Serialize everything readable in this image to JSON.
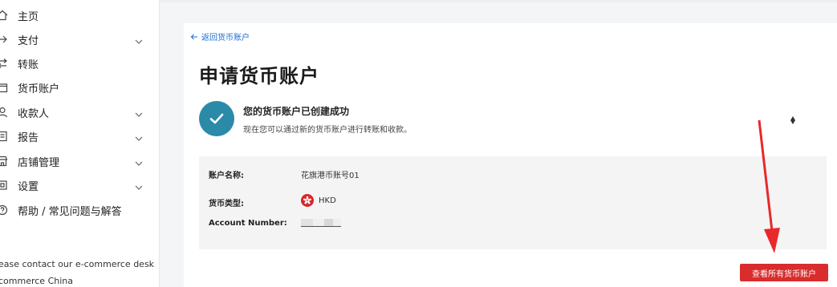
{
  "sidebar": {
    "items": [
      {
        "label": "主页",
        "icon": "home-icon",
        "chevron": false
      },
      {
        "label": "支付",
        "icon": "payment-arrow-icon",
        "chevron": true
      },
      {
        "label": "转账",
        "icon": "transfer-icon",
        "chevron": false
      },
      {
        "label": "货币账户",
        "icon": "wallet-icon",
        "chevron": false
      },
      {
        "label": "收款人",
        "icon": "person-icon",
        "chevron": true
      },
      {
        "label": "报告",
        "icon": "report-icon",
        "chevron": true
      },
      {
        "label": "店铺管理",
        "icon": "store-icon",
        "chevron": true
      },
      {
        "label": "设置",
        "icon": "settings-icon",
        "chevron": true
      },
      {
        "label": "帮助 / 常见问题与解答",
        "icon": "help-icon",
        "chevron": false
      }
    ],
    "contact_line1": "ease contact our e-commerce desk",
    "contact_line2": "commerce China"
  },
  "main": {
    "back_label": "返回货币账户",
    "title": "申请货币账户",
    "success_title": "您的货币账户已创建成功",
    "success_desc": "现在您可以通过新的货币账户进行转账和收款。",
    "details": {
      "account_name_label": "账户名称:",
      "account_name_value": "花旗港币账号01",
      "currency_label": "货币类型:",
      "currency_value": "HKD",
      "account_number_label": "Account Number:"
    },
    "view_all_button": "查看所有货币账户"
  },
  "colors": {
    "accent": "#2a8aa8",
    "link": "#1a6fd1",
    "button": "#d92c2c",
    "annotation_arrow": "#e8282a"
  }
}
